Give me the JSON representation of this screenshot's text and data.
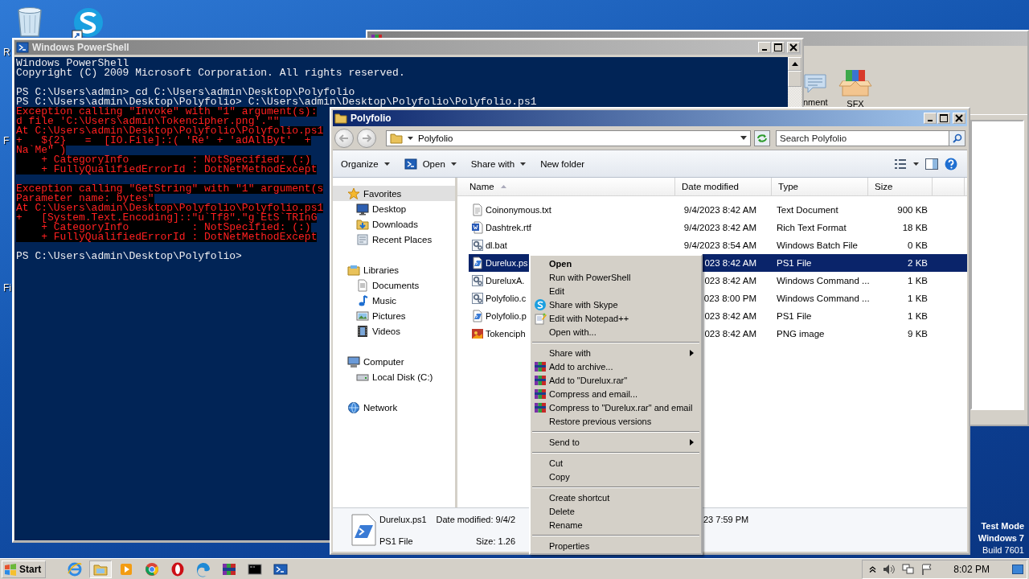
{
  "desktop": {
    "icon_labels": [
      "R",
      "F",
      "Fi"
    ],
    "test_mode": [
      "Test Mode",
      "Windows 7",
      "Build 7601"
    ]
  },
  "archiver_window": {
    "toolbar_labels": [
      "nment",
      "SFX"
    ]
  },
  "powershell": {
    "title": "Windows PowerShell",
    "lines": [
      {
        "kind": "output",
        "text": "Windows PowerShell"
      },
      {
        "kind": "output",
        "text": "Copyright (C) 2009 Microsoft Corporation. All rights reserved."
      },
      {
        "kind": "blank"
      },
      {
        "kind": "output",
        "text": "PS C:\\Users\\admin> cd C:\\Users\\admin\\Desktop\\Polyfolio"
      },
      {
        "kind": "output",
        "text": "PS C:\\Users\\admin\\Desktop\\Polyfolio> C:\\Users\\admin\\Desktop\\Polyfolio\\Polyfolio.ps1"
      },
      {
        "kind": "error",
        "text": "Exception calling \"Invoke\" with \"1\" argument(s):"
      },
      {
        "kind": "error",
        "text": "d file 'C:\\Users\\admin\\Tokencipher.png'.\"\""
      },
      {
        "kind": "error",
        "text": "At C:\\Users\\admin\\Desktop\\Polyfolio\\Polyfolio.ps1"
      },
      {
        "kind": "error",
        "text": "+   ${2}   =  [IO.File]::( 'Re' + 'adAllByt'  +"
      },
      {
        "kind": "error",
        "text": "Na`Me\" )"
      },
      {
        "kind": "error",
        "text": "    + CategoryInfo          : NotSpecified: (:)"
      },
      {
        "kind": "error",
        "text": "    + FullyQualifiedErrorId : DotNetMethodExcept"
      },
      {
        "kind": "blank"
      },
      {
        "kind": "error",
        "text": "Exception calling \"GetString\" with \"1\" argument(s"
      },
      {
        "kind": "error",
        "text": "Parameter name: bytes\""
      },
      {
        "kind": "error",
        "text": "At C:\\Users\\admin\\Desktop\\Polyfolio\\Polyfolio.ps1"
      },
      {
        "kind": "error",
        "text": "+   [System.Text.Encoding]::\"u`Tf8\".\"g`EtS`TRInG"
      },
      {
        "kind": "error",
        "text": "    + CategoryInfo          : NotSpecified: (:)"
      },
      {
        "kind": "error",
        "text": "    + FullyQualifiedErrorId : DotNetMethodExcept"
      },
      {
        "kind": "blank"
      },
      {
        "kind": "output",
        "text": "PS C:\\Users\\admin\\Desktop\\Polyfolio>"
      }
    ]
  },
  "explorer": {
    "title": "Polyfolio",
    "address": "Polyfolio",
    "search": {
      "placeholder": "Search Polyfolio"
    },
    "toolbar": [
      {
        "label": "Organize",
        "dropdown": true
      },
      {
        "label": "Open",
        "dropdown": true
      },
      {
        "label": "Share with",
        "dropdown": true
      },
      {
        "label": "New folder",
        "dropdown": false
      }
    ],
    "nav": [
      {
        "label": "Favorites",
        "selected": true,
        "children": [
          {
            "label": "Desktop",
            "selected": false
          },
          {
            "label": "Downloads",
            "selected": false
          },
          {
            "label": "Recent Places",
            "selected": false
          }
        ]
      },
      {
        "label": "Libraries",
        "selected": false,
        "children": [
          {
            "label": "Documents",
            "selected": false
          },
          {
            "label": "Music",
            "selected": false
          },
          {
            "label": "Pictures",
            "selected": false
          },
          {
            "label": "Videos",
            "selected": false
          }
        ]
      },
      {
        "label": "Computer",
        "selected": false,
        "children": [
          {
            "label": "Local Disk (C:)",
            "selected": false
          }
        ]
      },
      {
        "label": "Network",
        "selected": false
      }
    ],
    "columns": [
      {
        "label": "Name",
        "sorted": true
      },
      {
        "label": "Date modified",
        "sorted": false
      },
      {
        "label": "Type",
        "sorted": false
      },
      {
        "label": "Size",
        "sorted": false
      }
    ],
    "files": [
      {
        "name": "Coinonymous.txt",
        "date": "9/4/2023 8:42 AM",
        "type": "Text Document",
        "size": "900 KB",
        "selected": false
      },
      {
        "name": "Dashtrek.rtf",
        "date": "9/4/2023 8:42 AM",
        "type": "Rich Text Format",
        "size": "18 KB",
        "selected": false
      },
      {
        "name": "dl.bat",
        "date": "9/4/2023 8:54 AM",
        "type": "Windows Batch File",
        "size": "0 KB",
        "selected": false
      },
      {
        "name": "Durelux.ps",
        "date": "023 8:42 AM",
        "type": "PS1 File",
        "size": "2 KB",
        "selected": true
      },
      {
        "name": "DureluxA.",
        "date": "023 8:42 AM",
        "type": "Windows Command ...",
        "size": "1 KB",
        "selected": false
      },
      {
        "name": "Polyfolio.c",
        "date": "023 8:00 PM",
        "type": "Windows Command ...",
        "size": "1 KB",
        "selected": false
      },
      {
        "name": "Polyfolio.p",
        "date": "023 8:42 AM",
        "type": "PS1 File",
        "size": "1 KB",
        "selected": false
      },
      {
        "name": "Tokenciph",
        "date": "023 8:42 AM",
        "type": "PNG image",
        "size": "9 KB",
        "selected": false
      }
    ],
    "details": {
      "name": "Durelux.ps1",
      "modified": "Date modified: 9/4/2",
      "type": "PS1 File",
      "size": "Size: 1.26",
      "created": "23 7:59 PM"
    }
  },
  "context_menu": {
    "items": [
      {
        "kind": "item",
        "label": "Open",
        "default": true,
        "submenu": false
      },
      {
        "kind": "item",
        "label": "Run with PowerShell",
        "default": false,
        "submenu": false
      },
      {
        "kind": "item",
        "label": "Edit",
        "default": false,
        "submenu": false
      },
      {
        "kind": "item",
        "label": "Share with Skype",
        "default": false,
        "submenu": false
      },
      {
        "kind": "item",
        "label": "Edit with Notepad++",
        "default": false,
        "submenu": false
      },
      {
        "kind": "item",
        "label": "Open with...",
        "default": false,
        "submenu": false
      },
      {
        "kind": "separator"
      },
      {
        "kind": "item",
        "label": "Share with",
        "default": false,
        "submenu": true
      },
      {
        "kind": "item",
        "label": "Add to archive...",
        "default": false,
        "submenu": false
      },
      {
        "kind": "item",
        "label": "Add to \"Durelux.rar\"",
        "default": false,
        "submenu": false
      },
      {
        "kind": "item",
        "label": "Compress and email...",
        "default": false,
        "submenu": false
      },
      {
        "kind": "item",
        "label": "Compress to \"Durelux.rar\" and email",
        "default": false,
        "submenu": false
      },
      {
        "kind": "item",
        "label": "Restore previous versions",
        "default": false,
        "submenu": false
      },
      {
        "kind": "separator"
      },
      {
        "kind": "item",
        "label": "Send to",
        "default": false,
        "submenu": true
      },
      {
        "kind": "separator"
      },
      {
        "kind": "item",
        "label": "Cut",
        "default": false,
        "submenu": false
      },
      {
        "kind": "item",
        "label": "Copy",
        "default": false,
        "submenu": false
      },
      {
        "kind": "separator"
      },
      {
        "kind": "item",
        "label": "Create shortcut",
        "default": false,
        "submenu": false
      },
      {
        "kind": "item",
        "label": "Delete",
        "default": false,
        "submenu": false
      },
      {
        "kind": "item",
        "label": "Rename",
        "default": false,
        "submenu": false
      },
      {
        "kind": "separator"
      },
      {
        "kind": "item",
        "label": "Properties",
        "default": false,
        "submenu": false
      }
    ]
  },
  "taskbar": {
    "start": "Start",
    "buttons": [
      {
        "active": false
      },
      {
        "active": true
      },
      {
        "active": false
      },
      {
        "active": false
      },
      {
        "active": false
      },
      {
        "active": false
      },
      {
        "active": false
      },
      {
        "active": false
      },
      {
        "active": false
      }
    ],
    "clock": "8:02 PM"
  }
}
